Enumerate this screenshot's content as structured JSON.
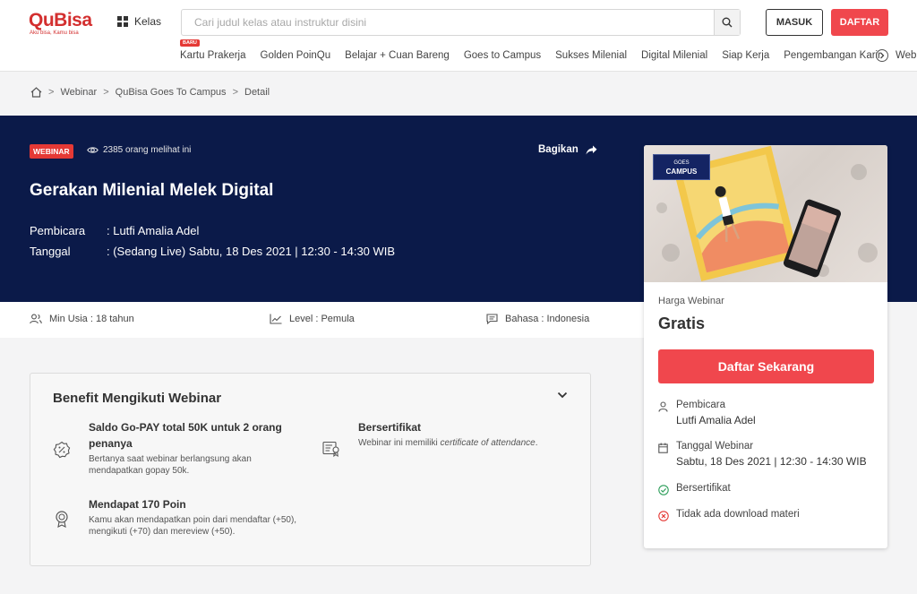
{
  "header": {
    "logo": "QuBisa",
    "logo_tagline": "Aku bisa, Kamu bisa",
    "kelas_label": "Kelas",
    "search_placeholder": "Cari judul kelas atau instruktur disini",
    "masuk_label": "MASUK",
    "daftar_label": "DAFTAR",
    "nav": [
      {
        "label": "Kartu Prakerja",
        "badge": "BARU"
      },
      {
        "label": "Golden PoinQu"
      },
      {
        "label": "Belajar + Cuan Bareng"
      },
      {
        "label": "Goes to Campus"
      },
      {
        "label": "Sukses Milenial"
      },
      {
        "label": "Digital Milenial"
      },
      {
        "label": "Siap Kerja"
      },
      {
        "label": "Pengembangan Karir"
      },
      {
        "label": "Web"
      }
    ]
  },
  "breadcrumb": {
    "items": [
      "Webinar",
      "QuBisa Goes To Campus",
      "Detail"
    ],
    "separator": ">"
  },
  "hero": {
    "tag": "WEBINAR",
    "views": "2385 orang melihat ini",
    "share_label": "Bagikan",
    "title": "Gerakan Milenial Melek Digital",
    "pembicara_label": "Pembicara",
    "pembicara_value": ": Lutfi Amalia Adel",
    "tanggal_label": "Tanggal",
    "tanggal_value": ": (Sedang Live) Sabtu, 18 Des 2021 | 12:30 - 14:30 WIB"
  },
  "info": {
    "usia": "Min Usia : 18 tahun",
    "level": "Level : Pemula",
    "bahasa": "Bahasa : Indonesia"
  },
  "benefit": {
    "title": "Benefit Mengikuti Webinar",
    "items": [
      {
        "title": "Saldo Go-PAY total 50K untuk 2 orang penanya",
        "desc": "Bertanya saat webinar berlangsung akan mendapatkan gopay 50k."
      },
      {
        "title": "Bersertifikat",
        "desc_prefix": "Webinar ini memiliki ",
        "desc_italic": "certificate of attendance",
        "desc_suffix": "."
      },
      {
        "title": "Mendapat 170 Poin",
        "desc": "Kamu akan mendapatkan poin dari mendaftar (+50), mengikuti (+70) dan mereview (+50)."
      }
    ]
  },
  "side": {
    "thumb_badge_top": "GOES",
    "thumb_badge": "CAMPUS",
    "price_label": "Harga Webinar",
    "price": "Gratis",
    "button_label": "Daftar Sekarang",
    "pembicara_label": "Pembicara",
    "pembicara_value": "Lutfi Amalia Adel",
    "tanggal_label": "Tanggal Webinar",
    "tanggal_value": "Sabtu, 18 Des 2021 | 12:30 - 14:30 WIB",
    "sertifikat": "Bersertifikat",
    "materi": "Tidak ada download materi"
  },
  "colors": {
    "brand_red": "#f0474d",
    "hero_navy": "#0b1a49",
    "check_green": "#2e9e5b",
    "cross_red": "#e53935"
  }
}
